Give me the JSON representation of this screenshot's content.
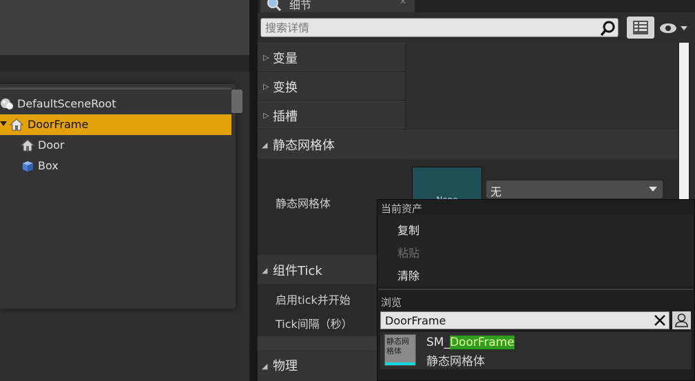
{
  "outliner": {
    "items": [
      {
        "label": "DefaultSceneRoot",
        "icon": "scene-root-icon",
        "indent": 0,
        "selected": false
      },
      {
        "label": "DoorFrame",
        "icon": "house-icon",
        "indent": 0,
        "selected": true
      },
      {
        "label": "Door",
        "icon": "house-icon",
        "indent": 1,
        "selected": false
      },
      {
        "label": "Box",
        "icon": "cube-icon",
        "indent": 1,
        "selected": false
      }
    ],
    "selected_color": "#e3a20a"
  },
  "details": {
    "tab_title": "细节",
    "search_placeholder": "搜索详情",
    "categories": {
      "variables": "变量",
      "transform": "变换",
      "sockets": "插槽",
      "static_mesh": "静态网格体",
      "component_tick": "组件Tick",
      "physics": "物理"
    },
    "static_mesh_property": {
      "label": "静态网格体",
      "thumbnail_text": "None",
      "value": "无"
    },
    "tick_properties": {
      "enable": "启用tick并开始",
      "interval": "Tick间隔（秒）"
    }
  },
  "popup": {
    "current_asset_header": "当前资产",
    "menu": {
      "copy": "复制",
      "paste": "粘贴",
      "clear": "清除"
    },
    "browse_header": "浏览",
    "search_value": "DoorFrame",
    "result": {
      "name_prefix": "SM_",
      "name_match": "DoorFrame",
      "type": "静态网格体",
      "thumb_text": "静态网格体"
    },
    "match_highlight_color": "#2f9e1e"
  }
}
